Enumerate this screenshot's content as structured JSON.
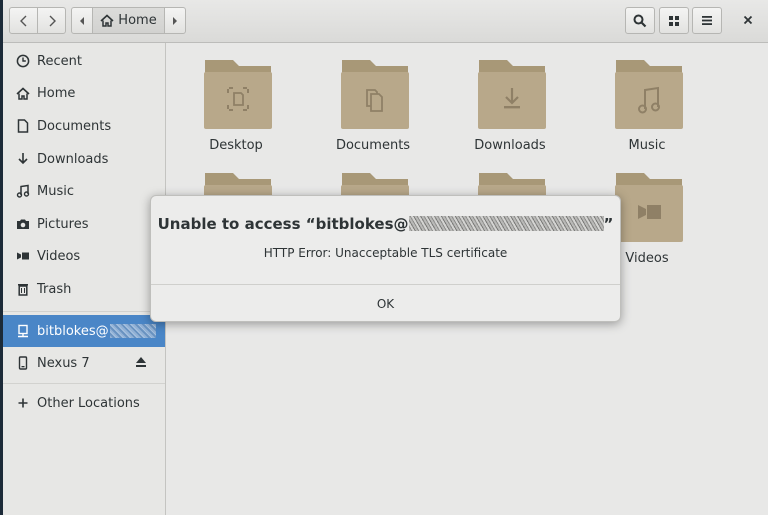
{
  "header": {
    "path_label": "Home",
    "icons": {
      "back": "chevron-left-icon",
      "forward": "chevron-right-icon",
      "path_left": "triangle-left-icon",
      "path_right": "triangle-right-icon",
      "home": "home-icon",
      "search": "search-icon",
      "view": "grid-view-icon",
      "menu": "hamburger-menu-icon",
      "close": "close-icon"
    }
  },
  "sidebar": {
    "items": [
      {
        "label": "Recent",
        "icon": "clock-icon"
      },
      {
        "label": "Home",
        "icon": "home-icon"
      },
      {
        "label": "Documents",
        "icon": "document-icon"
      },
      {
        "label": "Downloads",
        "icon": "download-icon"
      },
      {
        "label": "Music",
        "icon": "music-icon"
      },
      {
        "label": "Pictures",
        "icon": "camera-icon"
      },
      {
        "label": "Videos",
        "icon": "video-icon"
      },
      {
        "label": "Trash",
        "icon": "trash-icon"
      }
    ],
    "network": {
      "label": "bitblokes@",
      "icon": "network-server-icon",
      "selected": true
    },
    "device": {
      "label": "Nexus 7",
      "icon": "phone-icon",
      "eject_icon": "eject-icon"
    },
    "other": {
      "label": "Other Locations",
      "icon": "plus-icon"
    }
  },
  "folders": [
    {
      "label": "Desktop",
      "emblem": "desktop-emblem-icon"
    },
    {
      "label": "Documents",
      "emblem": "documents-emblem-icon"
    },
    {
      "label": "Downloads",
      "emblem": "download-emblem-icon"
    },
    {
      "label": "Music",
      "emblem": "music-emblem-icon"
    },
    {
      "label": "",
      "emblem": "pictures-emblem-icon"
    },
    {
      "label": "",
      "emblem": "public-emblem-icon"
    },
    {
      "label": "",
      "emblem": "templates-emblem-icon"
    },
    {
      "label": "Videos",
      "emblem": "video-emblem-icon"
    }
  ],
  "dialog": {
    "title_prefix": "Unable to access “bitblokes@",
    "title_suffix": "”",
    "message": "HTTP Error: Unacceptable TLS certificate",
    "ok_label": "OK"
  },
  "colors": {
    "selection": "#4a86c7",
    "folder": "#b8a88a",
    "folder_dark": "#a89877",
    "window_bg": "#e8e8e7"
  }
}
